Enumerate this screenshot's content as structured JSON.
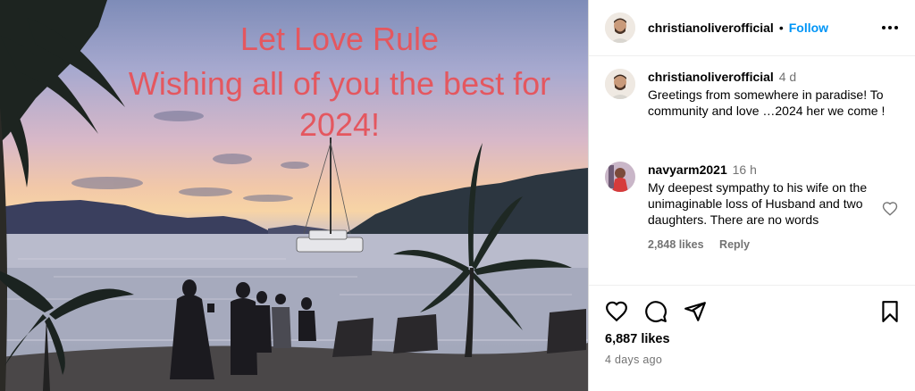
{
  "photo": {
    "overlay_line1": "Let Love Rule",
    "overlay_line2": "Wishing all of you the best for",
    "overlay_line3": "2024!",
    "overlay_color": "#e4575f"
  },
  "header": {
    "username": "christianoliverofficial",
    "separator": "•",
    "follow_label": "Follow",
    "more_icon": "more-horizontal-icon"
  },
  "comments": [
    {
      "username": "christianoliverofficial",
      "time": "4 d",
      "text": "Greetings from somewhere in paradise! To community and love …2024 her we come !"
    },
    {
      "username": "navyarm2021",
      "time": "16 h",
      "text": "My deepest sympathy to his wife on the unimaginable loss of Husband and two daughters. There are no words",
      "likes": "2,848 likes",
      "reply_label": "Reply"
    }
  ],
  "actions": {
    "like_icon": "heart-icon",
    "comment_icon": "comment-icon",
    "share_icon": "share-icon",
    "save_icon": "bookmark-icon"
  },
  "post": {
    "likes": "6,887 likes",
    "posted": "4 days ago"
  },
  "colors": {
    "link_blue": "#0095f6",
    "muted_gray": "#737373",
    "divider": "#dbdbdb"
  }
}
